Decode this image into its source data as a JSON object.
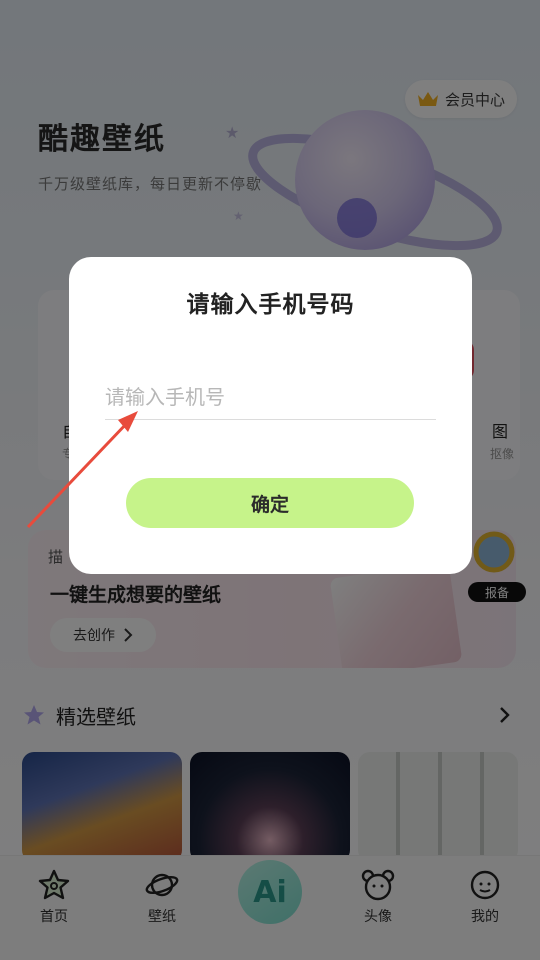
{
  "header": {
    "vip_label": "会员中心",
    "app_title": "酷趣壁纸",
    "app_subtitle": "千万级壁纸库，每日更新不停歇"
  },
  "tools": [
    {
      "name": "自制",
      "desc": "专属"
    },
    {
      "name": "图",
      "desc": "抠像"
    }
  ],
  "banner": {
    "tag": "描",
    "title": "一键生成想要的壁纸",
    "button_label": "去创作",
    "report_label": "报备"
  },
  "section": {
    "title": "精选壁纸"
  },
  "tabbar": {
    "items": [
      {
        "label": "首页"
      },
      {
        "label": "壁纸"
      },
      {
        "label": "Ai"
      },
      {
        "label": "头像"
      },
      {
        "label": "我的"
      }
    ]
  },
  "dialog": {
    "title": "请输入手机号码",
    "input_placeholder": "请输入手机号",
    "input_value": "",
    "confirm_label": "确定"
  },
  "colors": {
    "confirm_button": "#c6f38a",
    "overlay": "rgba(0,0,0,0.5)",
    "arrow": "#e84b3c"
  }
}
